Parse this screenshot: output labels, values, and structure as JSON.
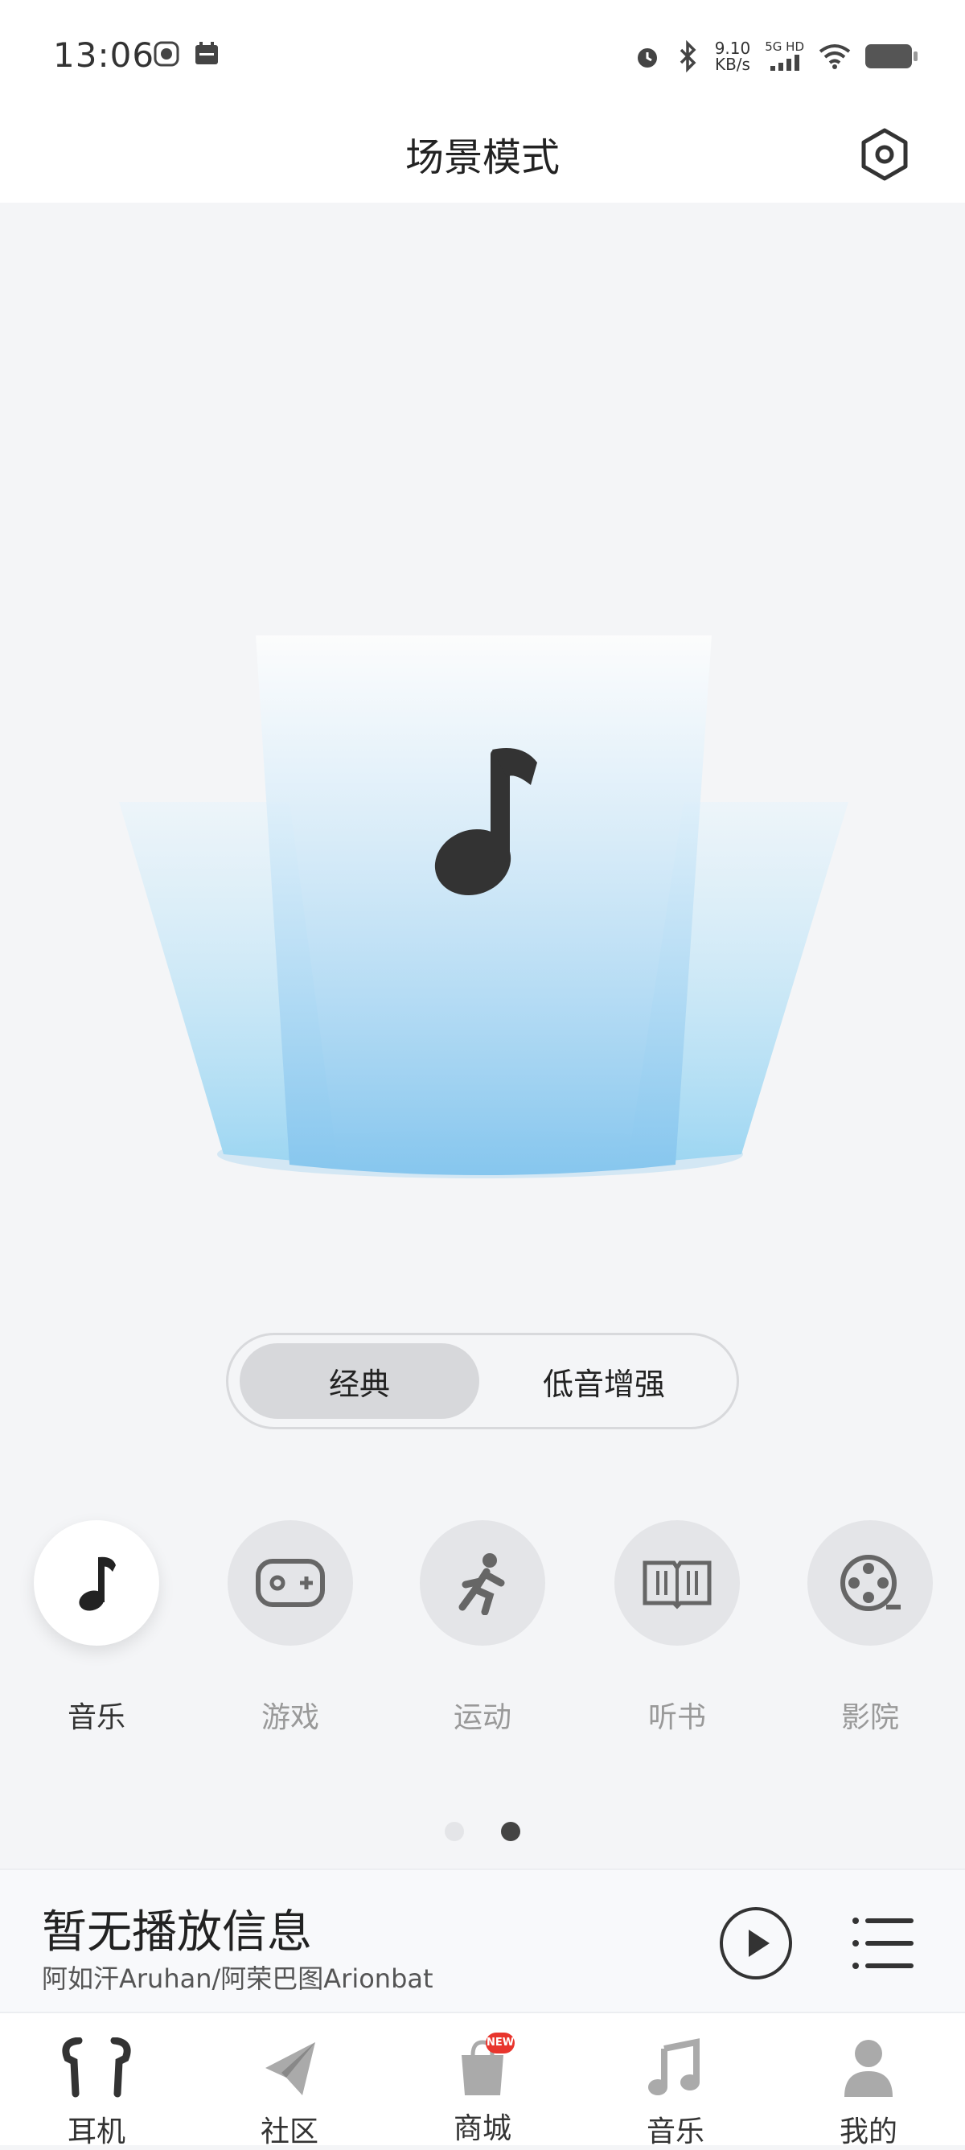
{
  "status_bar": {
    "time": "13:06",
    "net_speed_value": "9.10",
    "net_speed_unit": "KB/s",
    "network_type": "5G HD"
  },
  "header": {
    "title": "场景模式",
    "settings_icon": "settings-hexagon-icon"
  },
  "stage": {
    "center_icon": "music-note-icon",
    "beam_color": "#8cc8ec"
  },
  "sound_mode": {
    "options": [
      "经典",
      "低音增强"
    ],
    "selected": "经典"
  },
  "scenes": [
    {
      "label": "音乐",
      "icon": "music-note-icon",
      "active": true
    },
    {
      "label": "游戏",
      "icon": "gamepad-icon",
      "active": false
    },
    {
      "label": "运动",
      "icon": "running-icon",
      "active": false
    },
    {
      "label": "听书",
      "icon": "book-icon",
      "active": false
    },
    {
      "label": "影院",
      "icon": "film-reel-icon",
      "active": false
    }
  ],
  "pager": {
    "page": 2,
    "total": 2
  },
  "player": {
    "title": "暂无播放信息",
    "artist": "阿如汗Aruhan/阿荣巴图Arionbat"
  },
  "tabbar": {
    "tabs": [
      {
        "label": "耳机",
        "icon": "earbuds-icon",
        "active": true
      },
      {
        "label": "社区",
        "icon": "paper-plane-icon",
        "active": false
      },
      {
        "label": "商城",
        "icon": "shopping-bag-icon",
        "active": false,
        "badge": "NEW"
      },
      {
        "label": "音乐",
        "icon": "music-note-icon",
        "active": false
      },
      {
        "label": "我的",
        "icon": "person-icon",
        "active": false
      }
    ]
  },
  "colors": {
    "accent_dark": "#333333",
    "badge_red": "#e8352d",
    "background": "#f4f5f7"
  }
}
